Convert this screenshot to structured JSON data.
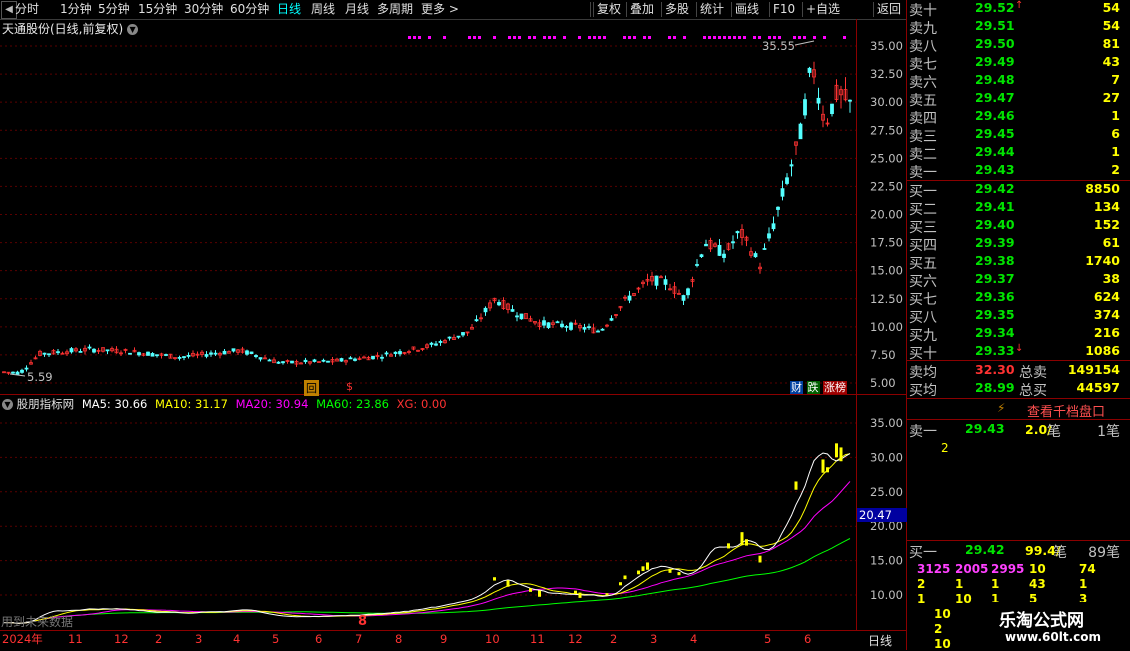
{
  "toolbar": {
    "left": [
      "分时",
      "1分钟",
      "5分钟",
      "15分钟",
      "30分钟",
      "60分钟",
      "日线",
      "周线",
      "月线",
      "多周期",
      "更多 >"
    ],
    "active": "日线",
    "right": [
      "复权",
      "叠加",
      "多股",
      "统计",
      "画线",
      "F10",
      "+自选",
      "返回"
    ]
  },
  "main_chart": {
    "title": "天通股份(日线,前复权)",
    "high_label": "35.55",
    "low_label": "5.59",
    "y_ticks": [
      "35.00",
      "32.50",
      "30.00",
      "27.50",
      "25.00",
      "22.50",
      "20.00",
      "17.50",
      "15.00",
      "12.50",
      "10.00",
      "7.50",
      "5.00"
    ],
    "marks": [
      "回",
      "$"
    ],
    "badges": [
      "财",
      "跌",
      "涨榜"
    ]
  },
  "indicator": {
    "name": "股朋指标网",
    "ma5": "MA5: 30.66",
    "ma10": "MA10: 31.17",
    "ma20": "MA20: 30.94",
    "ma60": "MA60: 23.86",
    "xg": "XG: 0.00",
    "y_ticks": [
      "35.00",
      "30.00",
      "25.00",
      "20.00",
      "15.00",
      "10.00"
    ],
    "cursor_value": "20.47",
    "overlay_text": "用到未来数据",
    "mark": "8"
  },
  "x_axis": {
    "labels": [
      "2024年",
      "11",
      "12",
      "2",
      "3",
      "4",
      "5",
      "6",
      "7",
      "8",
      "9",
      "10",
      "11",
      "12",
      "2",
      "3",
      "4",
      "5",
      "6"
    ],
    "period": "日线"
  },
  "colors": {
    "ma5": "#ffffff",
    "ma10": "#ffff00",
    "ma20": "#ff00ff",
    "ma60": "#00ff00",
    "up": "#ff3232",
    "down": "#54ffff",
    "border": "#8b0000"
  },
  "order_book": {
    "sell": [
      {
        "label": "卖十",
        "price": "29.52",
        "vol": "54",
        "flag": "↑"
      },
      {
        "label": "卖九",
        "price": "29.51",
        "vol": "54"
      },
      {
        "label": "卖八",
        "price": "29.50",
        "vol": "81"
      },
      {
        "label": "卖七",
        "price": "29.49",
        "vol": "43"
      },
      {
        "label": "卖六",
        "price": "29.48",
        "vol": "7"
      },
      {
        "label": "卖五",
        "price": "29.47",
        "vol": "27"
      },
      {
        "label": "卖四",
        "price": "29.46",
        "vol": "1"
      },
      {
        "label": "卖三",
        "price": "29.45",
        "vol": "6"
      },
      {
        "label": "卖二",
        "price": "29.44",
        "vol": "1"
      },
      {
        "label": "卖一",
        "price": "29.43",
        "vol": "2"
      }
    ],
    "buy": [
      {
        "label": "买一",
        "price": "29.42",
        "vol": "8850"
      },
      {
        "label": "买二",
        "price": "29.41",
        "vol": "134"
      },
      {
        "label": "买三",
        "price": "29.40",
        "vol": "152"
      },
      {
        "label": "买四",
        "price": "29.39",
        "vol": "61"
      },
      {
        "label": "买五",
        "price": "29.38",
        "vol": "1740"
      },
      {
        "label": "买六",
        "price": "29.37",
        "vol": "38"
      },
      {
        "label": "买七",
        "price": "29.36",
        "vol": "624"
      },
      {
        "label": "买八",
        "price": "29.35",
        "vol": "374"
      },
      {
        "label": "买九",
        "price": "29.34",
        "vol": "216"
      },
      {
        "label": "买十",
        "price": "29.33",
        "vol": "1086",
        "flag": "↓"
      }
    ],
    "sell_avg_label": "卖均",
    "sell_avg": "32.30",
    "total_sell_label": "总卖",
    "total_sell": "149154",
    "buy_avg_label": "买均",
    "buy_avg": "28.99",
    "total_buy_label": "总买",
    "total_buy": "44597"
  },
  "thousand_book": {
    "button": "查看千档盘口",
    "sell1_label": "卖一",
    "sell1_price": "29.43",
    "sell1_avg": "2.0/",
    "sell1_unit": "笔",
    "sell1_count": "1笔",
    "sell1_detail": "2",
    "buy1_label": "买一",
    "buy1_price": "29.42",
    "buy1_avg": "99.4/",
    "buy1_unit": "笔",
    "buy1_count": "89笔",
    "detail_rows": [
      [
        "3125",
        "2005",
        "2995",
        "10",
        "74"
      ],
      [
        "2",
        "1",
        "1",
        "43",
        "1"
      ],
      [
        "1",
        "10",
        "1",
        "5",
        "3"
      ],
      [
        "10",
        "",
        "",
        "",
        ""
      ],
      [
        "2",
        "",
        "",
        "",
        ""
      ],
      [
        "10",
        "",
        "",
        "",
        ""
      ]
    ]
  },
  "watermark": {
    "title": "乐淘公式网",
    "url": "www.60lt.com"
  }
}
